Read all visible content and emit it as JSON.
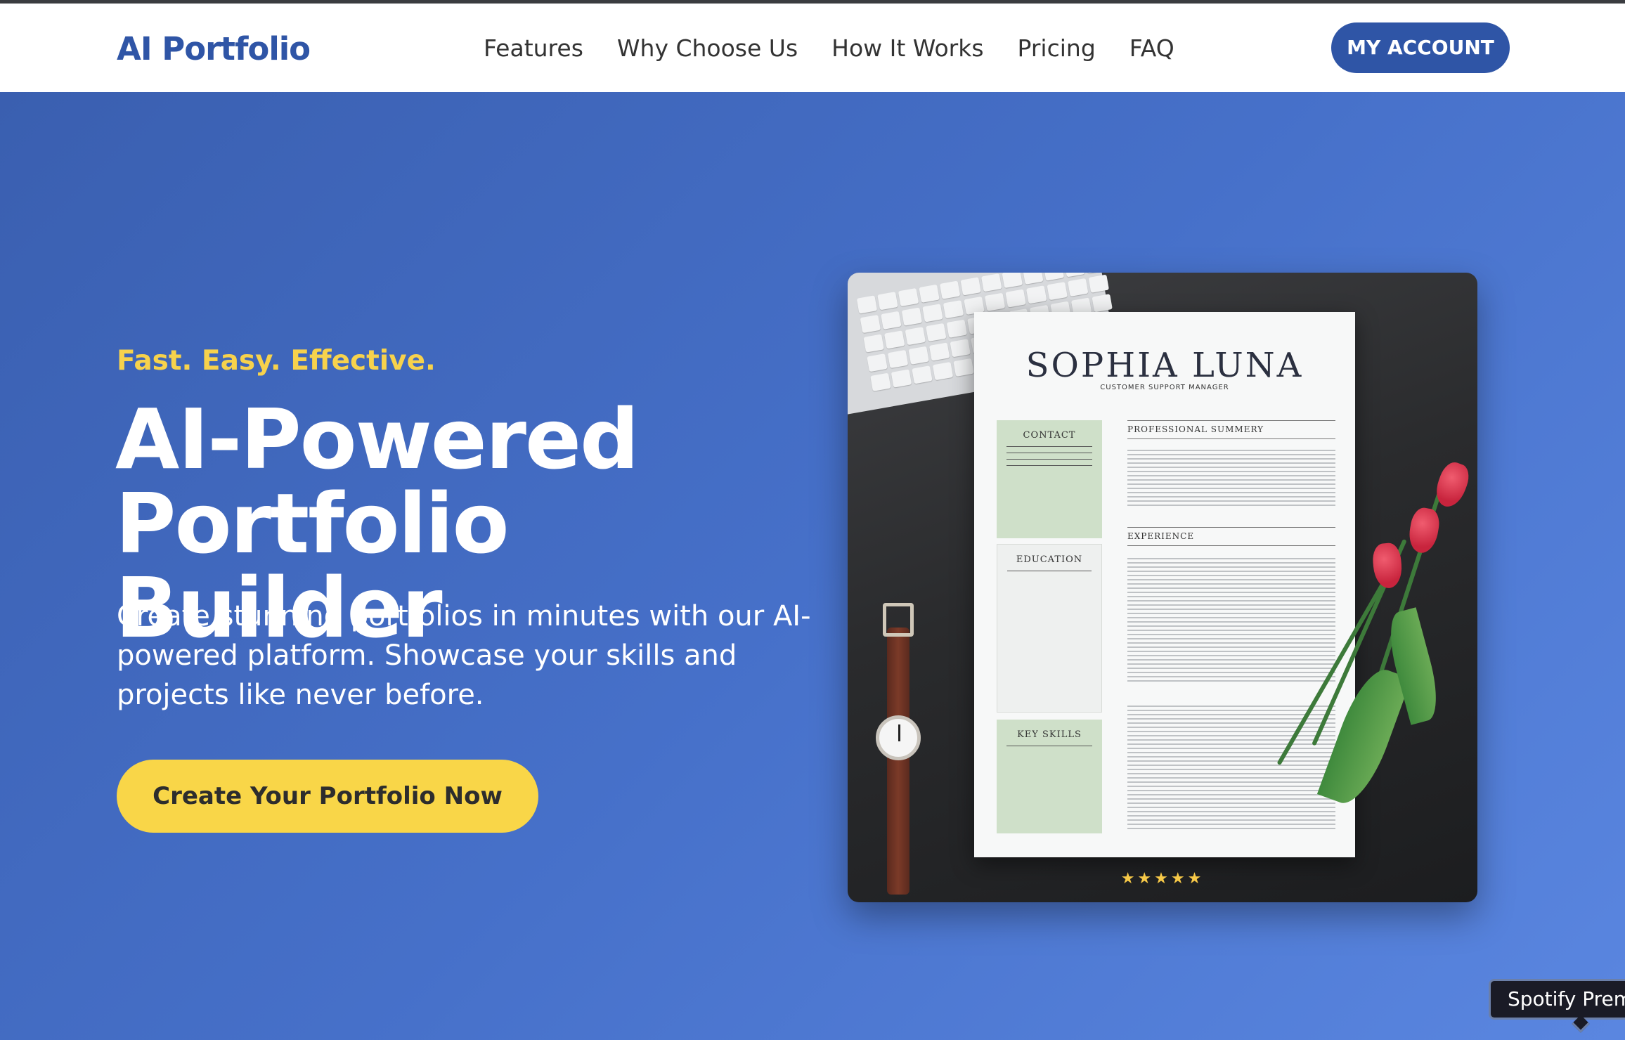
{
  "nav": {
    "logo": "AI Portfolio",
    "links": [
      "Features",
      "Why Choose Us",
      "How It Works",
      "Pricing",
      "FAQ"
    ],
    "account_label": "MY ACCOUNT"
  },
  "hero": {
    "tagline": "Fast. Easy. Effective.",
    "headline_line1": "AI-Powered",
    "headline_line2": "Portfolio Builder",
    "subtext": "Create stunning portfolios in minutes with our AI-powered platform. Showcase your skills and projects like never before.",
    "cta_label": "Create Your Portfolio Now"
  },
  "resume_image": {
    "name": "SOPHIA LUNA",
    "role": "CUSTOMER SUPPORT MANAGER",
    "sections": {
      "contact": "CONTACT",
      "education": "EDUCATION",
      "key_skills": "KEY SKILLS",
      "summary": "PROFESSIONAL SUMMERY",
      "experience": "EXPERIENCE"
    },
    "rating": "★★★★★"
  },
  "tooltip": {
    "label": "Spotify Prem"
  },
  "colors": {
    "brand": "#2f55a6",
    "accent": "#f9d648",
    "hero_bg": "#4670c9"
  }
}
